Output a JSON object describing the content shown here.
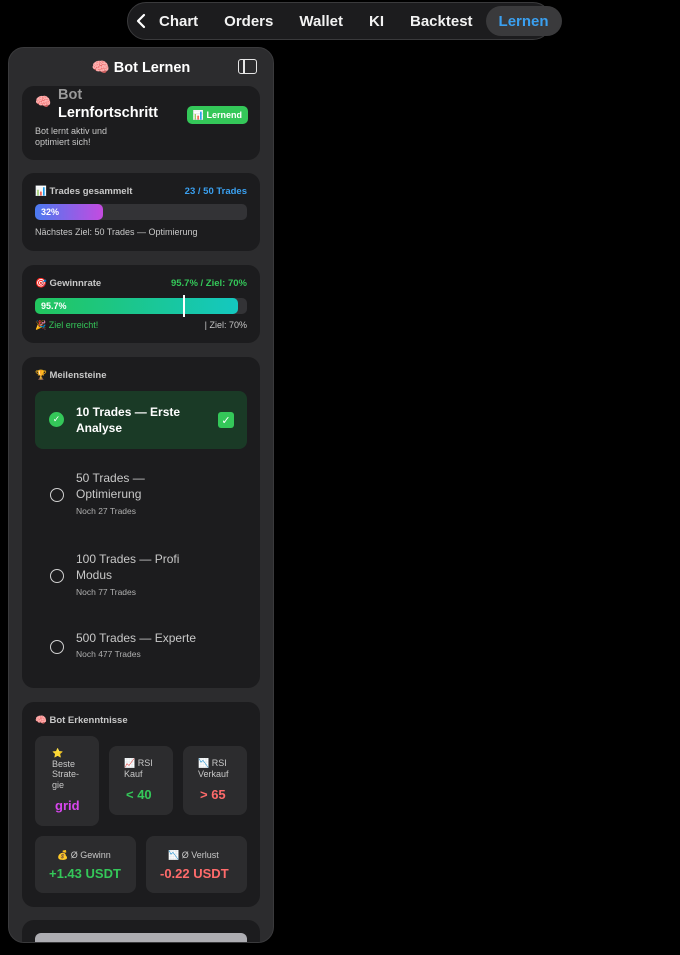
{
  "nav": {
    "tabs": [
      {
        "label": "Chart"
      },
      {
        "label": "Orders"
      },
      {
        "label": "Wallet"
      },
      {
        "label": "KI"
      },
      {
        "label": "Backtest"
      },
      {
        "label": "Lernen"
      }
    ],
    "active_tab": "Lernen"
  },
  "panel": {
    "emoji": "🧠",
    "title": "Bot Lernen"
  },
  "progress_card": {
    "emoji": "🧠",
    "title_line1": "Bot",
    "title_line2": "Lernfortschritt",
    "subtitle": "Bot lernt aktiv und optimiert sich!",
    "badge": "📊 Lernend"
  },
  "trades_card": {
    "label": "📊 Trades gesammelt",
    "value": "23 / 50 Trades",
    "percent_label": "32%",
    "progress": 0.32,
    "note": "Nächstes Ziel: 50 Trades — Optimierung"
  },
  "winrate_card": {
    "label": "🎯 Gewinnrate",
    "value": "95.7% / Ziel: 70%",
    "percent_label": "95.7%",
    "progress": 0.957,
    "target": 0.7,
    "achieved": "🎉 Ziel erreicht!",
    "target_note": "| Ziel: 70%"
  },
  "milestones_card": {
    "label": "🏆 Meilensteine",
    "items": [
      {
        "title": "10 Trades — Erste Analyse",
        "sub": "",
        "done": true
      },
      {
        "title": "50 Trades — Optimierung",
        "sub": "Noch 27 Trades",
        "done": false
      },
      {
        "title": "100 Trades — Profi Modus",
        "sub": "Noch 77 Trades",
        "done": false
      },
      {
        "title": "500 Trades — Experte",
        "sub": "Noch 477 Trades",
        "done": false
      }
    ]
  },
  "insights_card": {
    "label": "🧠 Bot Erkenntnisse",
    "best_strategy": {
      "label": "⭐ Beste Strate-gie",
      "value": "grid"
    },
    "rsi_buy": {
      "label": "📈 RSI Kauf",
      "value": "< 40"
    },
    "rsi_sell": {
      "label": "📉 RSI Verkauf",
      "value": "> 65"
    },
    "avg_gain": {
      "label": "💰 Ø Gewinn",
      "value": "+1.43 USDT"
    },
    "avg_loss": {
      "label": "📉 Ø Verlust",
      "value": "-0.22 USDT"
    }
  },
  "colors": {
    "accent_blue": "#3aa0f0",
    "green": "#34c759",
    "red": "#ff6b6b",
    "purple": "#d946ef"
  }
}
